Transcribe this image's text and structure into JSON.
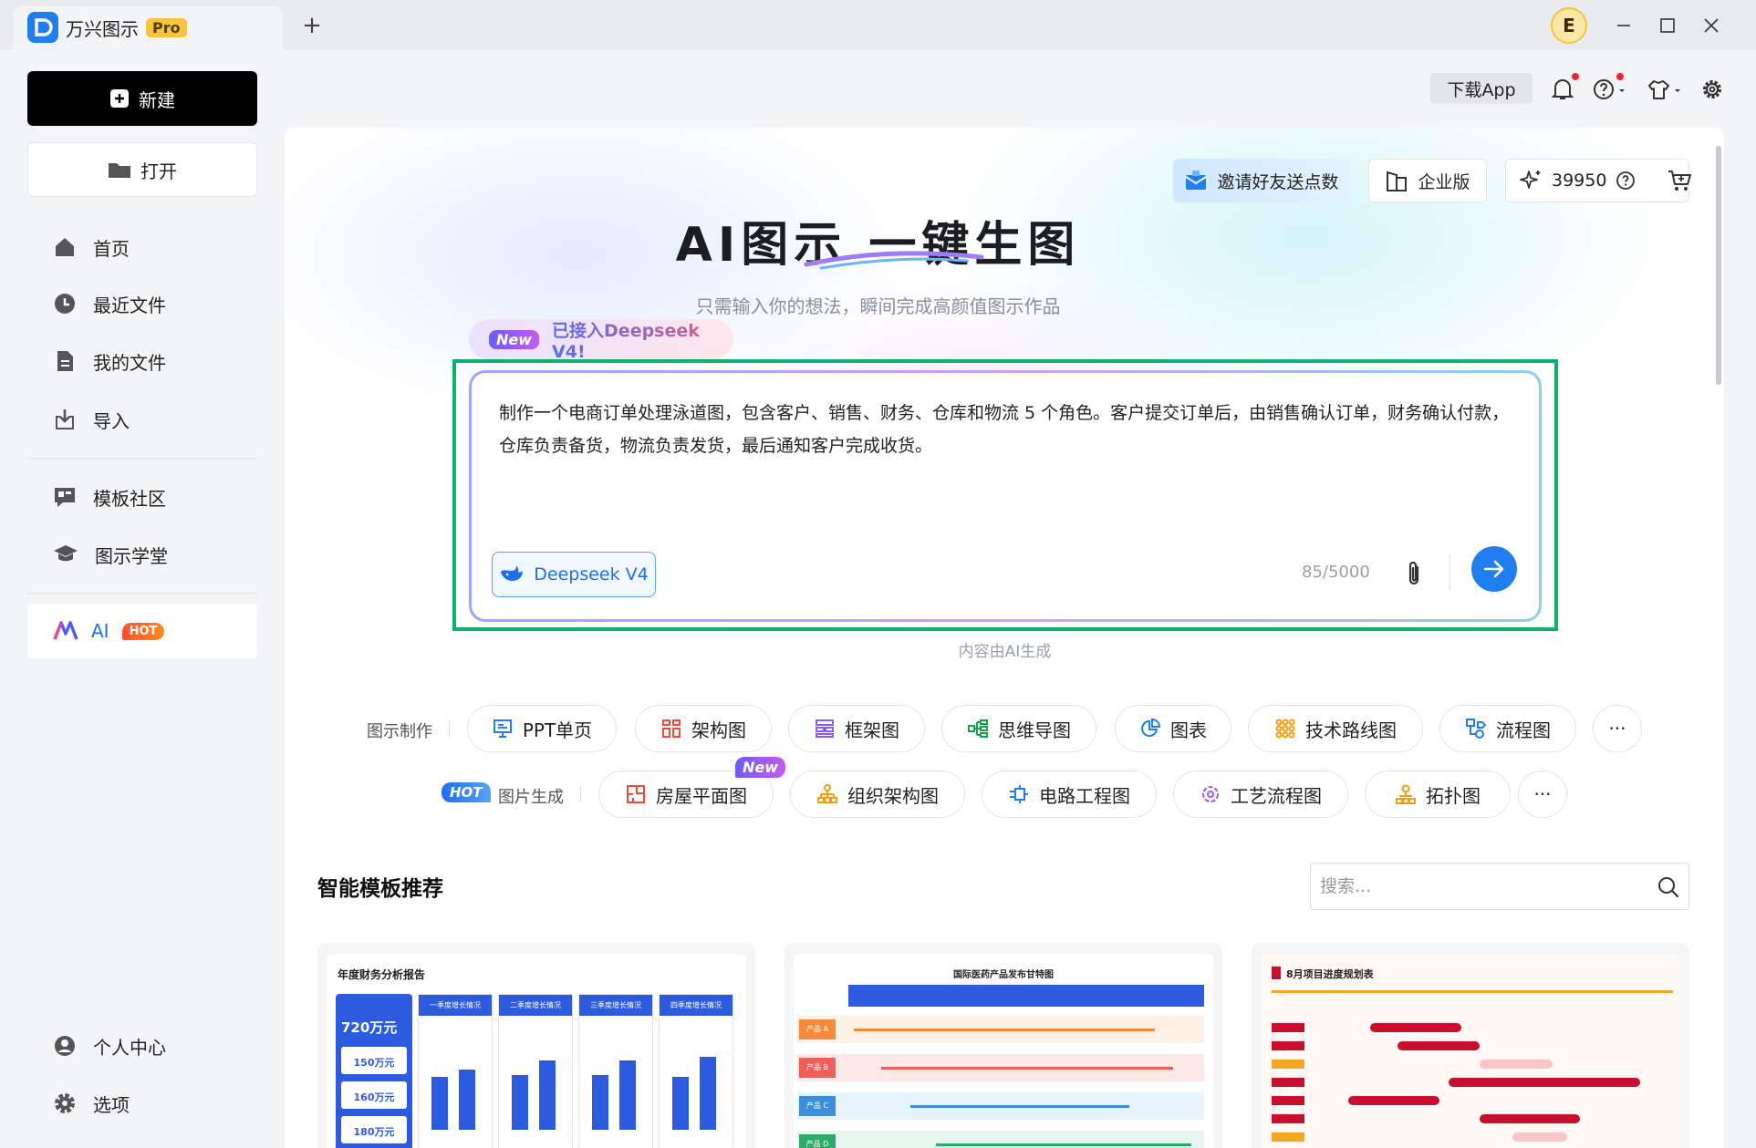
{
  "app": {
    "name": "万兴图示",
    "badge": "Pro",
    "avatar_initial": "E",
    "new_tab": "+"
  },
  "sidebar": {
    "new_label": "新建",
    "open_label": "打开",
    "nav": [
      "首页",
      "最近文件",
      "我的文件",
      "导入"
    ],
    "nav2": [
      "模板社区",
      "图示学堂"
    ],
    "ai_label": "AI",
    "ai_badge": "HOT",
    "bottom": [
      "个人中心",
      "选项"
    ]
  },
  "header": {
    "download_label": "下载App"
  },
  "hero": {
    "invite_label": "邀请好友送点数",
    "enterprise_label": "企业版",
    "points": "39950",
    "title": "AI图示 一键生图",
    "subtitle": "只需输入你的想法，瞬间完成高颜值图示作品",
    "banner_tag": "New",
    "banner_text": "已接入Deepseek V4!",
    "prompt": "制作一个电商订单处理泳道图，包含客户、销售、财务、仓库和物流 5 个角色。客户提交订单后，由销售确认订单，财务确认付款，仓库负责备货，物流负责发货，最后通知客户完成收货。",
    "model_label": "Deepseek V4",
    "char_count": "85/5000",
    "ai_note": "内容由AI生成"
  },
  "categories": {
    "row1_label": "图示制作",
    "row1": [
      "PPT单页",
      "架构图",
      "框架图",
      "思维导图",
      "图表",
      "技术路线图",
      "流程图"
    ],
    "row2_badge": "HOT",
    "row2_label": "图片生成",
    "row2": [
      "房屋平面图",
      "组织架构图",
      "电路工程图",
      "工艺流程图",
      "拓扑图"
    ],
    "row2_new_badge": "New",
    "more": "···"
  },
  "templates": {
    "title": "智能模板推荐",
    "search_placeholder": "搜索...",
    "cards": [
      {
        "title": "年度财务分析报告",
        "side_values": [
          "720万元",
          "150万元",
          "160万元",
          "180万元"
        ],
        "columns": [
          "一季度增长情况",
          "二季度增长情况",
          "三季度增长情况",
          "四季度增长情况"
        ]
      },
      {
        "title": "国际医药产品发布甘特图",
        "rows": [
          "产品 A",
          "产品 B",
          "产品 C",
          "产品 D"
        ]
      },
      {
        "title": "8月项目进度规划表"
      }
    ]
  },
  "colors": {
    "accent": "#1f7ff0",
    "highlight_frame": "#0fb26b"
  }
}
